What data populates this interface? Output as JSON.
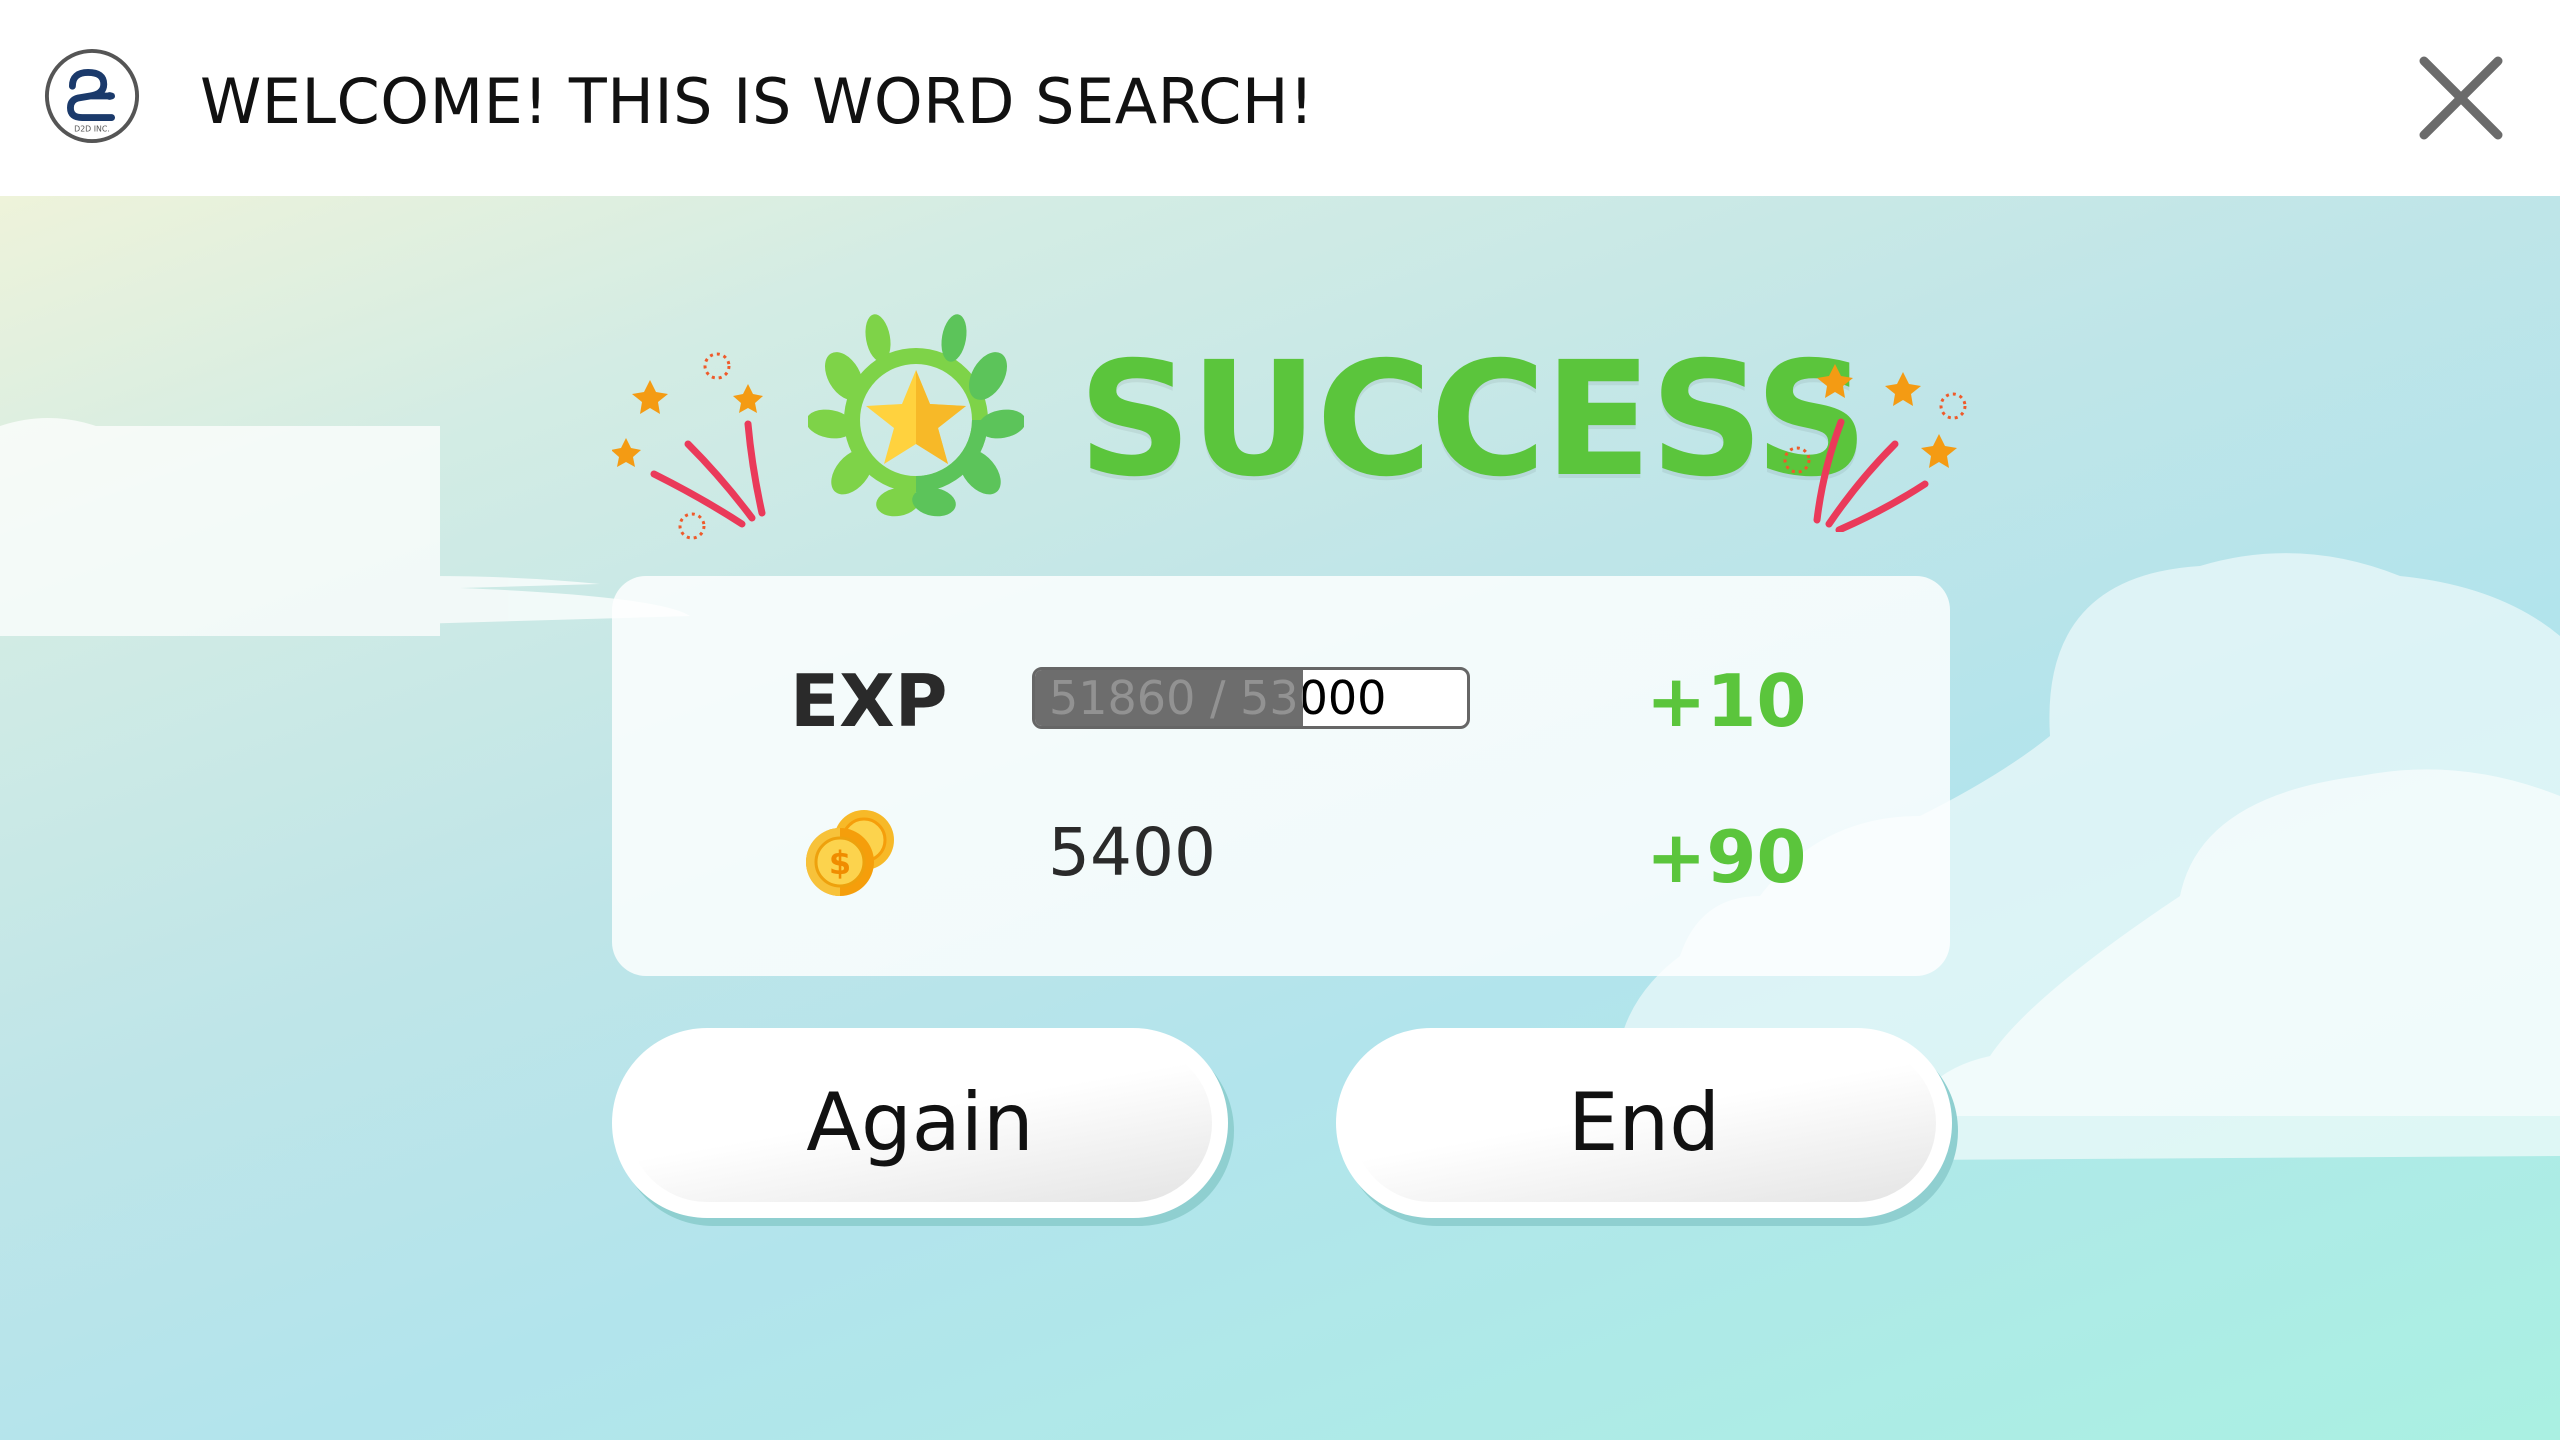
{
  "header": {
    "title": "WELCOME! THIS IS WORD SEARCH!",
    "logo_icon": "d2d-logo-icon",
    "close_icon": "close-icon"
  },
  "result": {
    "title": "SUCCESS",
    "title_color": "#5bc53c"
  },
  "stats": {
    "exp": {
      "label": "EXP",
      "current": 51860,
      "max": 53000,
      "display": "51860 / 53000",
      "gain": "+10"
    },
    "coins": {
      "icon": "coins-icon",
      "value": "5400",
      "gain": "+90"
    }
  },
  "buttons": {
    "again_label": "Again",
    "end_label": "End"
  }
}
